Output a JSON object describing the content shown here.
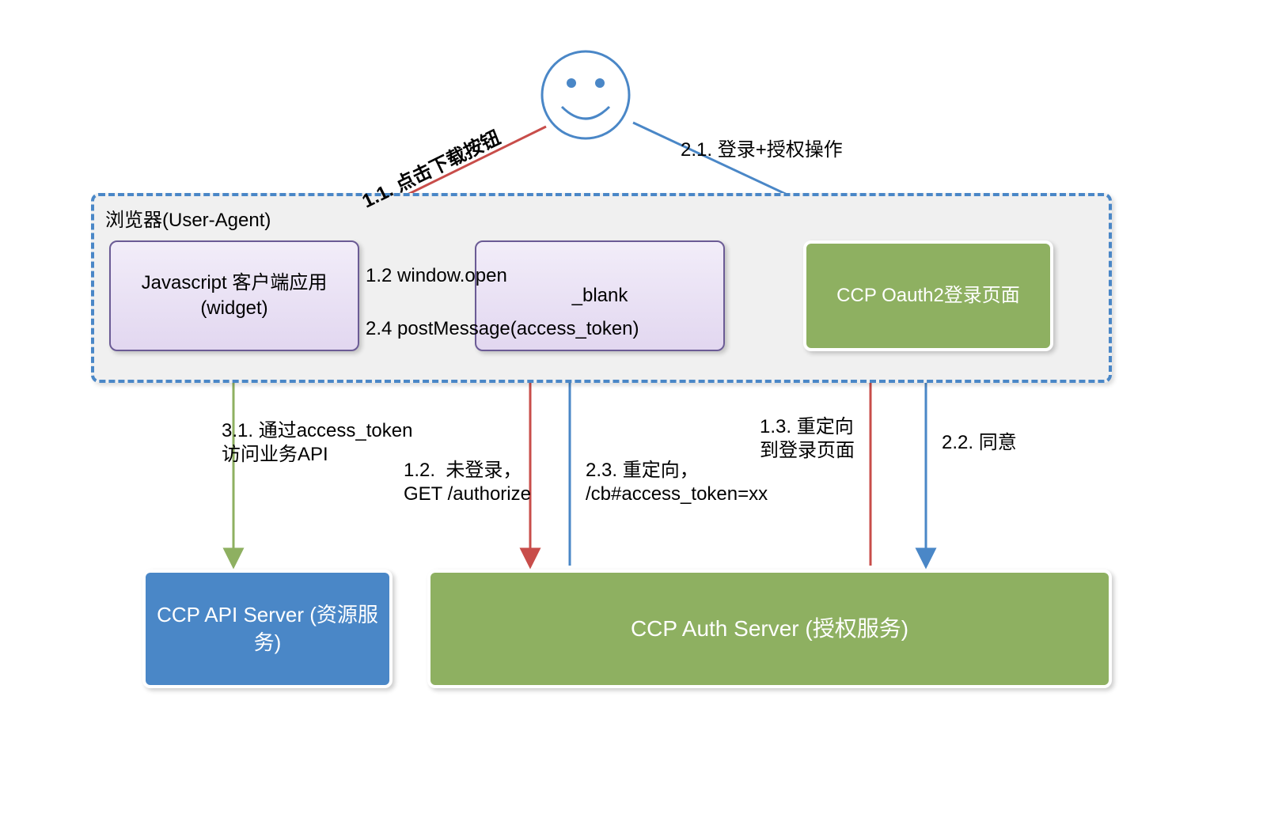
{
  "actor": "user-smiley",
  "browser": {
    "title": "浏览器(User-Agent)",
    "js_widget": "Javascript 客户端应用\n(widget)",
    "blank_window": "_blank",
    "oauth_login": "CCP Oauth2登录页面"
  },
  "servers": {
    "api": "CCP API Server\n(资源服务)",
    "auth": "CCP Auth Server\n(授权服务)"
  },
  "edges": {
    "e11": "1.1. 点击下载按钮",
    "e12a": "1.2 window.open",
    "e12b": "1.2.  未登录，\nGET /authorize",
    "e13": "1.3. 重定向\n到登录页面",
    "e21": "2.1. 登录+授权操作",
    "e22": "2.2. 同意",
    "e23": "2.3. 重定向，\n/cb#access_token=xx",
    "e24": "2.4 postMessage(access_token)",
    "e31": "3.1. 通过access_token\n访问业务API"
  },
  "colors": {
    "red": "#c84d4a",
    "blue": "#4a87c7",
    "green": "#8eb061"
  }
}
